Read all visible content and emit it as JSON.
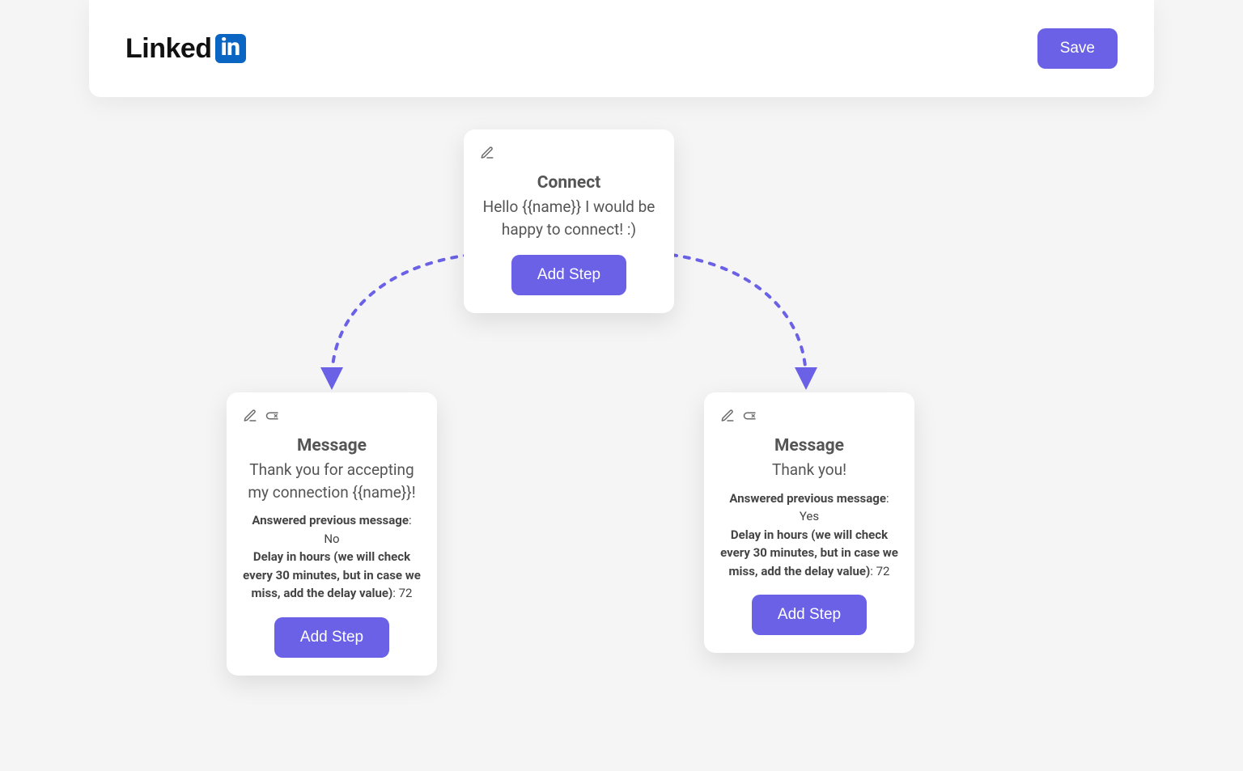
{
  "header": {
    "brand_part1": "Linked",
    "brand_part2": "in",
    "save_label": "Save"
  },
  "node_connect": {
    "title": "Connect",
    "body": "Hello {{name}} I would be happy to connect! :)",
    "add_step_label": "Add Step"
  },
  "node_left": {
    "title": "Message",
    "body": "Thank you for accepting my connection {{name}}!",
    "answered_label": "Answered previous message",
    "answered_value": ": No",
    "delay_label": "Delay in hours (we will check every 30 minutes, but in case we miss, add the delay value)",
    "delay_value": ": 72",
    "add_step_label": "Add Step"
  },
  "node_right": {
    "title": "Message",
    "body": "Thank you!",
    "answered_label": "Answered previous message",
    "answered_value": ": Yes",
    "delay_label": "Delay in hours (we will check every 30 minutes, but in case we miss, add the delay value)",
    "delay_value": ": 72",
    "add_step_label": "Add Step"
  }
}
